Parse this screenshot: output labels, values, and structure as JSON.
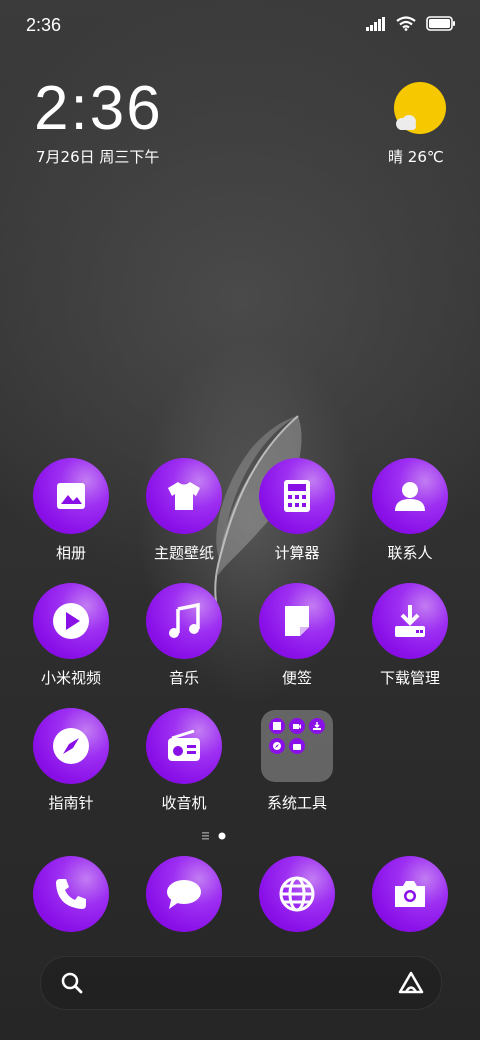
{
  "status_bar": {
    "time": "2:36",
    "battery_level_percent": 100
  },
  "clock_widget": {
    "time": "2:36",
    "date": "7月26日 周三下午"
  },
  "weather_widget": {
    "condition": "晴",
    "temperature": "26℃",
    "icon": "sunny-cloud-icon"
  },
  "apps": [
    {
      "label": "相册",
      "icon": "gallery-icon"
    },
    {
      "label": "主题壁纸",
      "icon": "themes-shirt-icon"
    },
    {
      "label": "计算器",
      "icon": "calculator-icon"
    },
    {
      "label": "联系人",
      "icon": "contacts-icon"
    },
    {
      "label": "小米视频",
      "icon": "video-play-icon"
    },
    {
      "label": "音乐",
      "icon": "music-note-icon"
    },
    {
      "label": "便签",
      "icon": "notes-icon"
    },
    {
      "label": "下载管理",
      "icon": "download-icon"
    },
    {
      "label": "指南针",
      "icon": "compass-icon"
    },
    {
      "label": "收音机",
      "icon": "radio-icon"
    },
    {
      "label": "系统工具",
      "icon": "folder-icon"
    }
  ],
  "page_indicator": {
    "count": 2,
    "active_index": 1
  },
  "dock": [
    {
      "icon": "phone-icon"
    },
    {
      "icon": "messages-icon"
    },
    {
      "icon": "browser-globe-icon"
    },
    {
      "icon": "camera-icon"
    }
  ],
  "search_bar": {
    "left_icon": "search-icon",
    "right_icon": "assistant-icon"
  },
  "colors": {
    "app_icon_accent": "#8a10e8",
    "weather_sun": "#f5c800"
  }
}
